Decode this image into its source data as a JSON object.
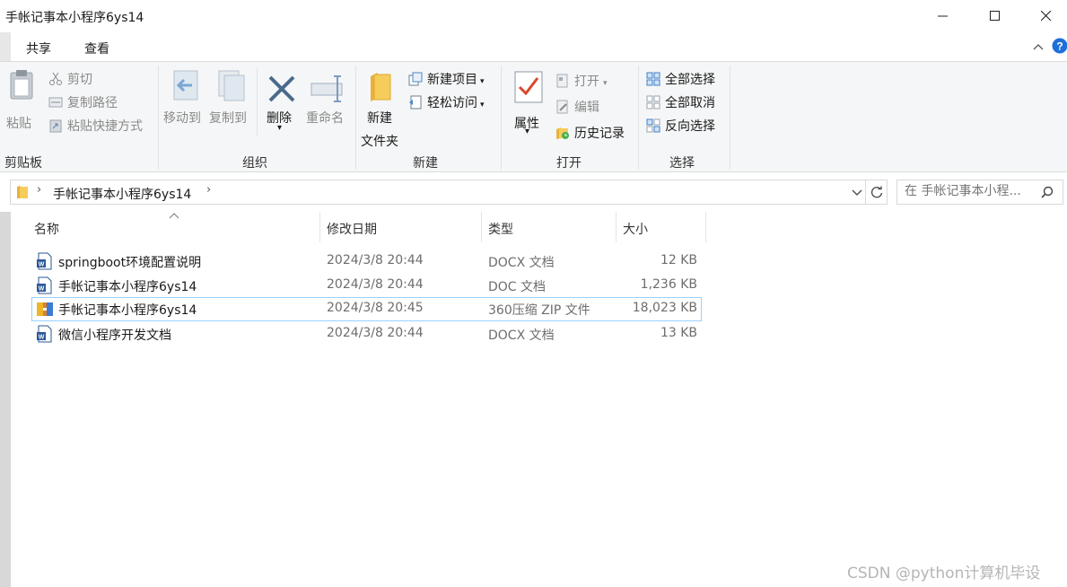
{
  "window": {
    "title": "手帐记事本小程序6ys14"
  },
  "tabs": [
    {
      "label": "共享"
    },
    {
      "label": "查看"
    }
  ],
  "ribbon": {
    "clipboard": {
      "paste": "粘贴",
      "cut": "剪切",
      "copy_path": "复制路径",
      "paste_shortcut": "粘贴快捷方式",
      "group": "剪贴板"
    },
    "organize": {
      "move_to": "移动到",
      "copy_to": "复制到",
      "delete": "删除",
      "rename": "重命名",
      "group": "组织"
    },
    "new": {
      "new_folder_line1": "新建",
      "new_folder_line2": "文件夹",
      "new_item": "新建项目",
      "easy_access": "轻松访问",
      "group": "新建"
    },
    "open": {
      "properties": "属性",
      "open": "打开",
      "edit": "编辑",
      "history": "历史记录",
      "group": "打开"
    },
    "select": {
      "select_all": "全部选择",
      "select_none": "全部取消",
      "invert": "反向选择",
      "group": "选择"
    }
  },
  "address": {
    "path": "手帐记事本小程序6ys14",
    "search_placeholder": "在 手帐记事本小程..."
  },
  "columns": {
    "name": "名称",
    "date": "修改日期",
    "type": "类型",
    "size": "大小"
  },
  "files": [
    {
      "name": "springboot环境配置说明",
      "date": "2024/3/8 20:44",
      "type": "DOCX 文档",
      "size": "12 KB",
      "icon": "word-doc-icon"
    },
    {
      "name": "手帐记事本小程序6ys14",
      "date": "2024/3/8 20:44",
      "type": "DOC 文档",
      "size": "1,236 KB",
      "icon": "word-doc-icon"
    },
    {
      "name": "手帐记事本小程序6ys14",
      "date": "2024/3/8 20:45",
      "type": "360压缩 ZIP 文件",
      "size": "18,023 KB",
      "icon": "zip-archive-icon"
    },
    {
      "name": "微信小程序开发文档",
      "date": "2024/3/8 20:44",
      "type": "DOCX 文档",
      "size": "13 KB",
      "icon": "word-doc-icon"
    }
  ],
  "watermark": "CSDN @python计算机毕设",
  "colors": {
    "accent": "#1e6fd9",
    "selection_border": "#99d1ff",
    "ribbon_bg": "#f5f6f7"
  }
}
